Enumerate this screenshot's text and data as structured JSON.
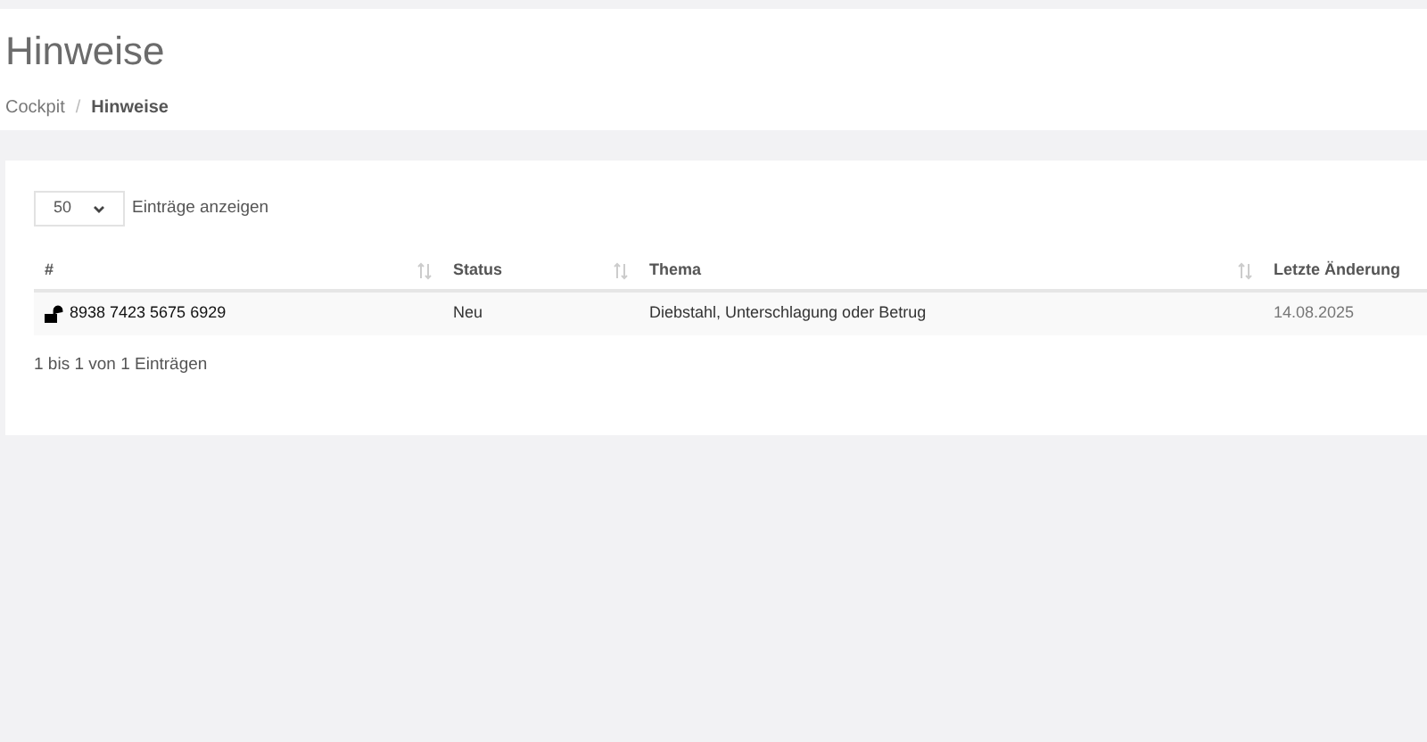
{
  "page_title": "Hinweise",
  "breadcrumb_separator": "/",
  "breadcrumb": [
    {
      "label": "Cockpit",
      "current": false
    },
    {
      "label": "Hinweise",
      "current": true
    }
  ],
  "page_length": {
    "value": "50",
    "label": "Einträge anzeigen"
  },
  "table": {
    "columns": [
      {
        "label": "#",
        "sort_icon": true
      },
      {
        "label": "Status",
        "sort_icon": true
      },
      {
        "label": "Thema",
        "sort_icon": true
      },
      {
        "label": "Letzte Änderung",
        "sort_icon": false
      }
    ],
    "rows": [
      {
        "cells": [
          "8938 7423 5675 6929",
          "Neu",
          "Diebstahl, Unterschlagung oder Betrug",
          "14.08.2025"
        ]
      }
    ]
  },
  "info": "1 bis 1 von 1 Einträgen"
}
